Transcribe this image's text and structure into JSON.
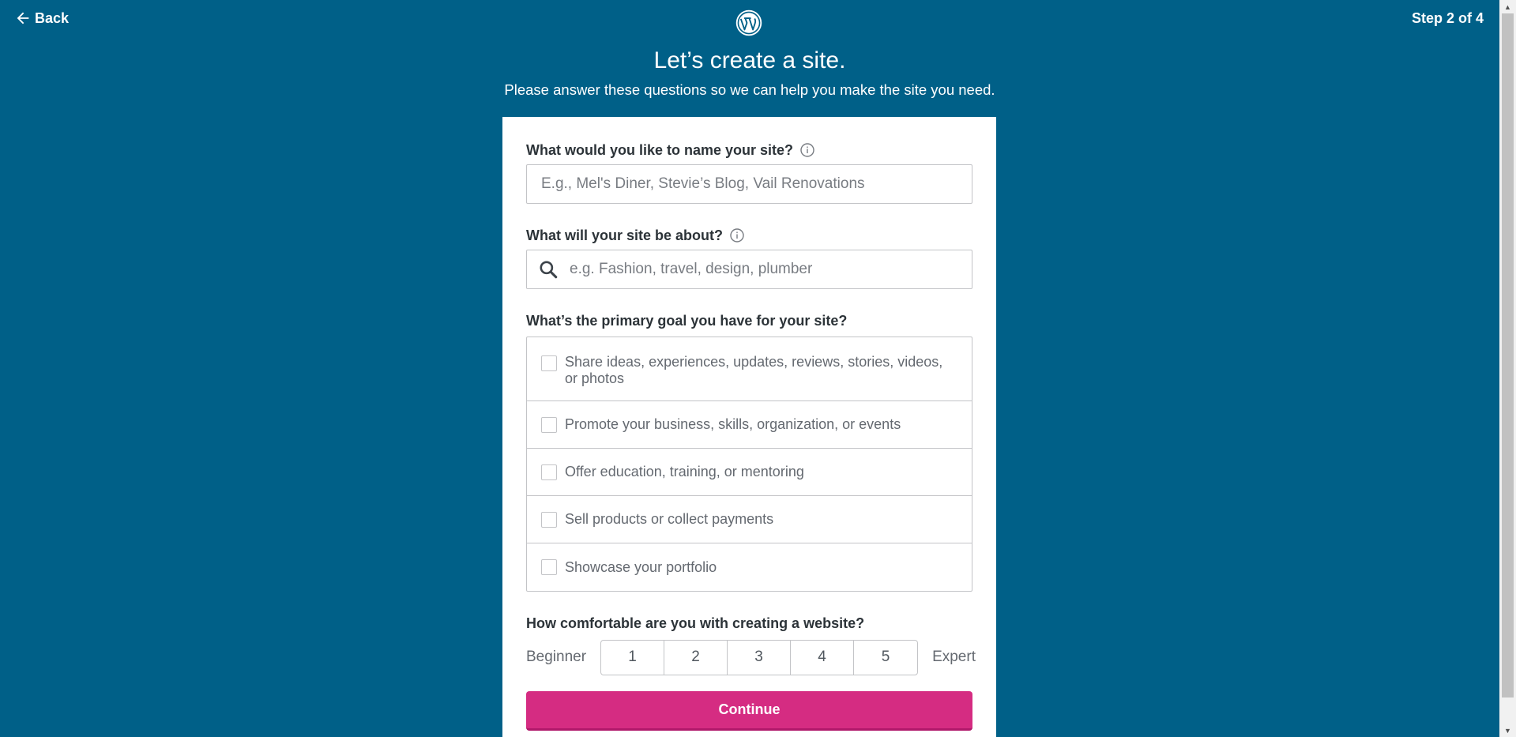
{
  "header": {
    "back_label": "Back",
    "step_label": "Step 2 of 4",
    "logo_icon": "wordpress-logo-icon"
  },
  "intro": {
    "title": "Let’s create a site.",
    "subtitle": "Please answer these questions so we can help you make the site you need."
  },
  "form": {
    "site_name": {
      "label": "What would you like to name your site?",
      "placeholder": "E.g., Mel's Diner, Stevie’s Blog, Vail Renovations",
      "value": ""
    },
    "site_topic": {
      "label": "What will your site be about?",
      "placeholder": "e.g. Fashion, travel, design, plumber",
      "value": ""
    },
    "goals": {
      "label": "What’s the primary goal you have for your site?",
      "options": [
        {
          "label": "Share ideas, experiences, updates, reviews, stories, videos, or photos",
          "checked": false
        },
        {
          "label": "Promote your business, skills, organization, or events",
          "checked": false
        },
        {
          "label": "Offer education, training, or mentoring",
          "checked": false
        },
        {
          "label": "Sell products or collect payments",
          "checked": false
        },
        {
          "label": "Showcase your portfolio",
          "checked": false
        }
      ]
    },
    "comfort": {
      "label": "How comfortable are you with creating a website?",
      "min_label": "Beginner",
      "max_label": "Expert",
      "options": [
        "1",
        "2",
        "3",
        "4",
        "5"
      ]
    },
    "continue_label": "Continue"
  },
  "colors": {
    "background": "#006088",
    "accent": "#d52c82"
  }
}
